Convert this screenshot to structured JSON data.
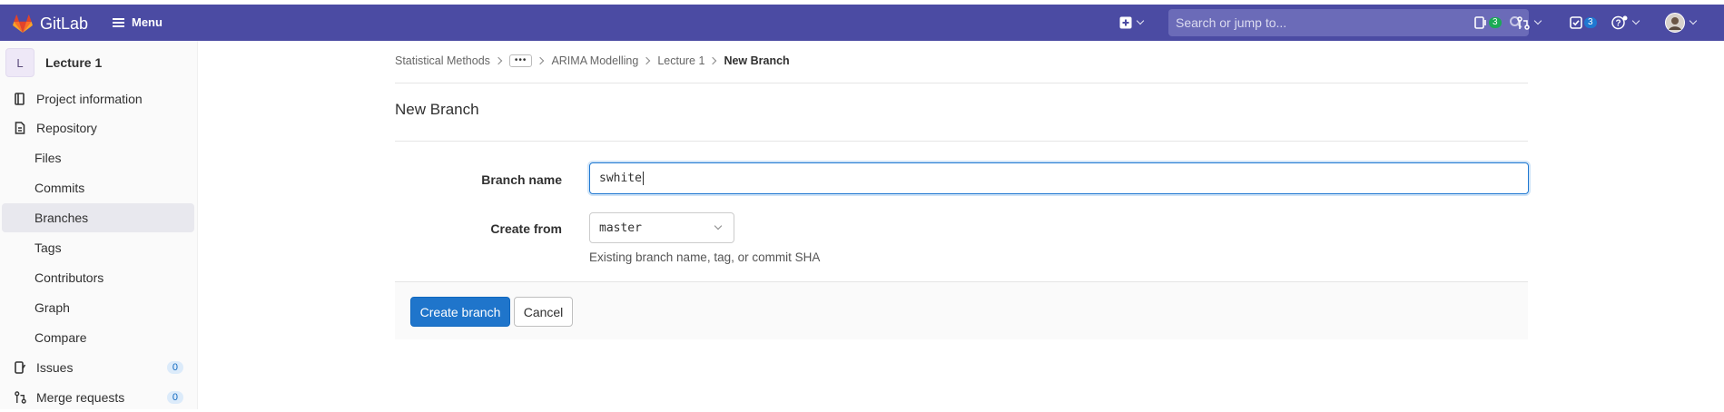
{
  "navbar": {
    "logo_text": "GitLab",
    "menu_label": "Menu",
    "search_placeholder": "Search or jump to...",
    "issues_count": "3",
    "todos_count": "3",
    "bg_color": "#4b4ba3"
  },
  "sidebar": {
    "project_initial": "L",
    "project_name": "Lecture 1",
    "items": [
      {
        "label": "Project information",
        "icon": "project-info-icon"
      },
      {
        "label": "Repository",
        "icon": "repository-icon"
      },
      {
        "label": "Files"
      },
      {
        "label": "Commits"
      },
      {
        "label": "Branches",
        "active": true
      },
      {
        "label": "Tags"
      },
      {
        "label": "Contributors"
      },
      {
        "label": "Graph"
      },
      {
        "label": "Compare"
      },
      {
        "label": "Issues",
        "icon": "issues-icon",
        "count": "0"
      },
      {
        "label": "Merge requests",
        "icon": "merge-request-icon",
        "count": "0"
      }
    ]
  },
  "breadcrumb": [
    "Statistical Methods",
    "•••",
    "ARIMA Modelling",
    "Lecture 1",
    "New Branch"
  ],
  "page": {
    "title": "New Branch",
    "branch_name_label": "Branch name",
    "branch_name_value": "swhite",
    "create_from_label": "Create from",
    "create_from_value": "master",
    "create_from_help": "Existing branch name, tag, or commit SHA",
    "create_button": "Create branch",
    "cancel_button": "Cancel"
  }
}
